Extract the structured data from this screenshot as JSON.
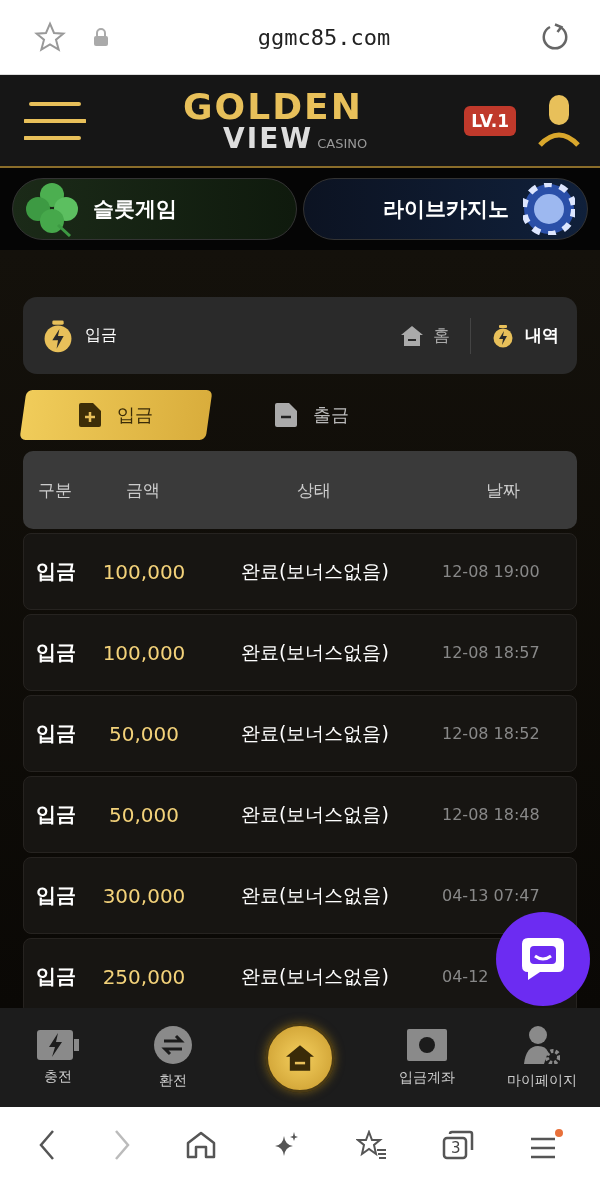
{
  "browser": {
    "url": "ggmc85.com",
    "tab_count": "3"
  },
  "header": {
    "logo_main": "GOLDEN",
    "logo_sub": "VIEW",
    "logo_tag": "CASINO",
    "level": "LV.1"
  },
  "games": [
    {
      "label": "슬롯게임",
      "kind": "slot"
    },
    {
      "label": "라이브카지노",
      "kind": "live"
    }
  ],
  "panel": {
    "title": "입금",
    "home": "홈",
    "history": "내역"
  },
  "tabs": [
    {
      "label": "입금",
      "kind": "plus",
      "selected": true
    },
    {
      "label": "출금",
      "kind": "minus",
      "selected": false
    }
  ],
  "table": {
    "columns": [
      "구분",
      "금액",
      "상태",
      "날짜"
    ],
    "rows": [
      [
        "입금",
        "100,000",
        "완료(보너스없음)",
        "12-08 19:00"
      ],
      [
        "입금",
        "100,000",
        "완료(보너스없음)",
        "12-08 18:57"
      ],
      [
        "입금",
        "50,000",
        "완료(보너스없음)",
        "12-08 18:52"
      ],
      [
        "입금",
        "50,000",
        "완료(보너스없음)",
        "12-08 18:48"
      ],
      [
        "입금",
        "300,000",
        "완료(보너스없음)",
        "04-13 07:47"
      ],
      [
        "입금",
        "250,000",
        "완료(보너스없음)",
        "04-12"
      ]
    ]
  },
  "bottom_nav": [
    {
      "label": "충전",
      "kind": "charge"
    },
    {
      "label": "환전",
      "kind": "exchange"
    },
    {
      "kind": "home"
    },
    {
      "label": "입금계좌",
      "kind": "account"
    },
    {
      "label": "마이페이지",
      "kind": "mypage"
    }
  ]
}
